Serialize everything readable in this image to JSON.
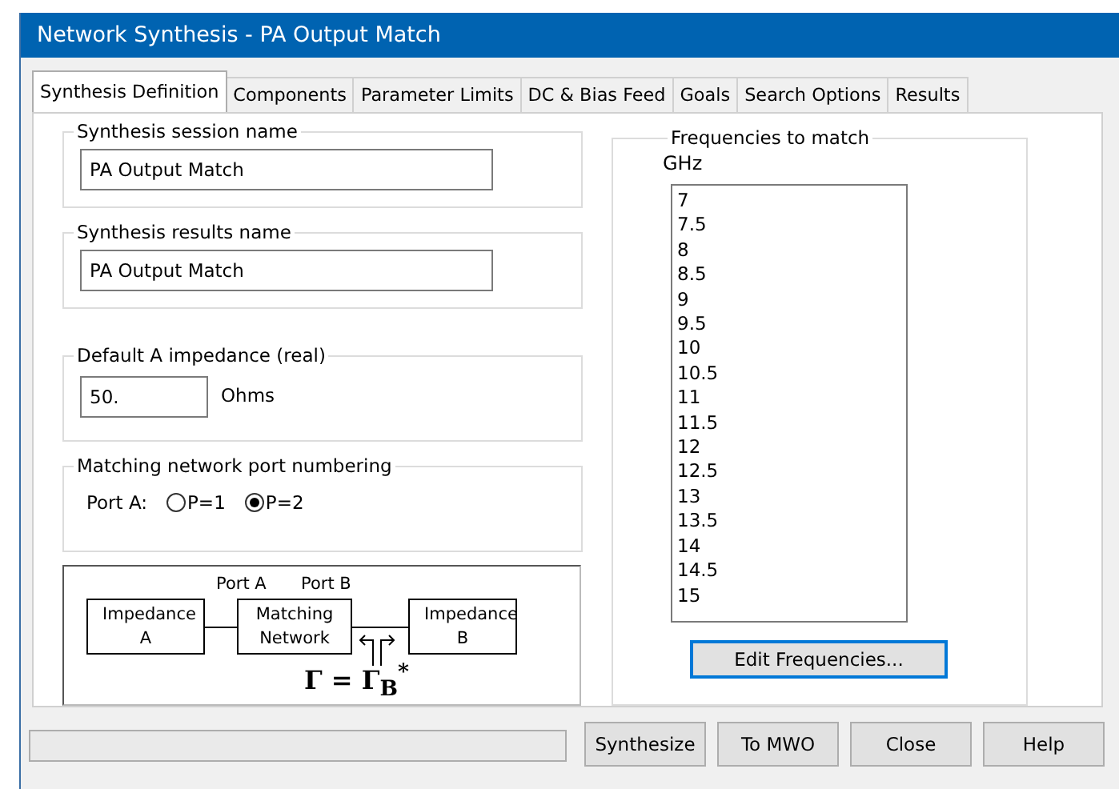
{
  "window": {
    "title": "Network Synthesis - PA Output Match"
  },
  "tabs": [
    {
      "label": "Synthesis Definition",
      "selected": true
    },
    {
      "label": "Components",
      "selected": false
    },
    {
      "label": "Parameter Limits",
      "selected": false
    },
    {
      "label": "DC & Bias Feed",
      "selected": false
    },
    {
      "label": "Goals",
      "selected": false
    },
    {
      "label": "Search Options",
      "selected": false
    },
    {
      "label": "Results",
      "selected": false
    }
  ],
  "session_name": {
    "label": "Synthesis session name",
    "value": "PA Output Match"
  },
  "results_name": {
    "label": "Synthesis results name",
    "value": "PA Output Match"
  },
  "impedance": {
    "label": "Default A impedance (real)",
    "value": "50.",
    "unit": "Ohms"
  },
  "port_numbering": {
    "label": "Matching network port numbering",
    "prompt": "Port A:",
    "options": [
      {
        "label": "P=1",
        "selected": false
      },
      {
        "label": "P=2",
        "selected": true
      }
    ]
  },
  "diagram": {
    "impedance_a": "Impedance A",
    "matching": "Matching Network",
    "impedance_b": "Impedance B",
    "port_a": "Port A",
    "port_b": "Port B",
    "formula": "Γ = Γ$_{B}$$^{*}$"
  },
  "frequencies": {
    "label": "Frequencies to match",
    "unit": "GHz",
    "values": [
      "7",
      "7.5",
      "8",
      "8.5",
      "9",
      "9.5",
      "10",
      "10.5",
      "11",
      "11.5",
      "12",
      "12.5",
      "13",
      "13.5",
      "14",
      "14.5",
      "15"
    ],
    "button": "Edit Frequencies..."
  },
  "buttons": [
    "Synthesize",
    "To MWO",
    "Close",
    "Help"
  ]
}
